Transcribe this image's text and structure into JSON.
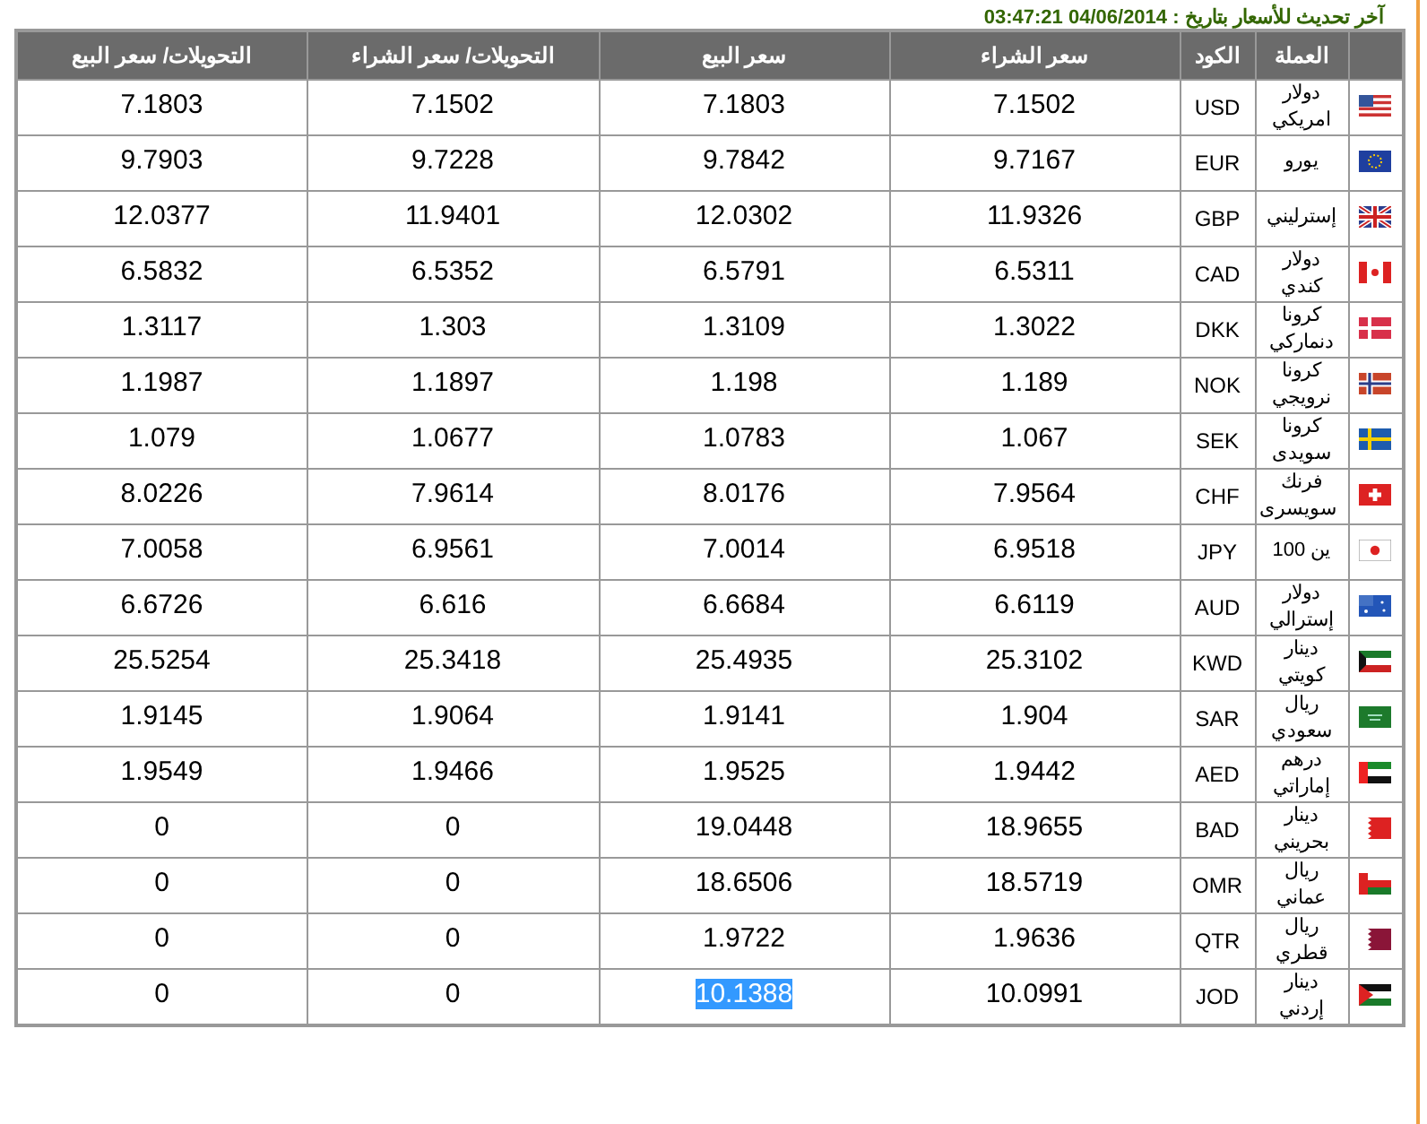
{
  "update_line": "آخر تحديث للأسعار بتاريخ : 04/06/2014 03:47:21",
  "table": {
    "columns": [
      "",
      "العملة",
      "الكود",
      "سعر الشراء",
      "سعر البيع",
      "التحويلات/ سعر الشراء",
      "التحويلات/ سعر البيع"
    ],
    "rows": [
      {
        "currency": "دولار امريكي",
        "code": "USD",
        "buy": "7.1502",
        "sell": "7.1803",
        "transfer_buy": "7.1502",
        "transfer_sell": "7.1803",
        "sell_selected": false
      },
      {
        "currency": "يورو",
        "code": "EUR",
        "buy": "9.7167",
        "sell": "9.7842",
        "transfer_buy": "9.7228",
        "transfer_sell": "9.7903",
        "sell_selected": false
      },
      {
        "currency": "إسترليني",
        "code": "GBP",
        "buy": "11.9326",
        "sell": "12.0302",
        "transfer_buy": "11.9401",
        "transfer_sell": "12.0377",
        "sell_selected": false
      },
      {
        "currency": "دولار كندي",
        "code": "CAD",
        "buy": "6.5311",
        "sell": "6.5791",
        "transfer_buy": "6.5352",
        "transfer_sell": "6.5832",
        "sell_selected": false
      },
      {
        "currency": "كرونا دنماركي",
        "code": "DKK",
        "buy": "1.3022",
        "sell": "1.3109",
        "transfer_buy": "1.303",
        "transfer_sell": "1.3117",
        "sell_selected": false
      },
      {
        "currency": "كرونا نرويجي",
        "code": "NOK",
        "buy": "1.189",
        "sell": "1.198",
        "transfer_buy": "1.1897",
        "transfer_sell": "1.1987",
        "sell_selected": false
      },
      {
        "currency": "كرونا سويدى",
        "code": "SEK",
        "buy": "1.067",
        "sell": "1.0783",
        "transfer_buy": "1.0677",
        "transfer_sell": "1.079",
        "sell_selected": false
      },
      {
        "currency": "فرنك سويسرى",
        "code": "CHF",
        "buy": "7.9564",
        "sell": "8.0176",
        "transfer_buy": "7.9614",
        "transfer_sell": "8.0226",
        "sell_selected": false
      },
      {
        "currency": "ين 100",
        "code": "JPY",
        "buy": "6.9518",
        "sell": "7.0014",
        "transfer_buy": "6.9561",
        "transfer_sell": "7.0058",
        "sell_selected": false
      },
      {
        "currency": "دولار إسترالي",
        "code": "AUD",
        "buy": "6.6119",
        "sell": "6.6684",
        "transfer_buy": "6.616",
        "transfer_sell": "6.6726",
        "sell_selected": false
      },
      {
        "currency": "دينار كويتي",
        "code": "KWD",
        "buy": "25.3102",
        "sell": "25.4935",
        "transfer_buy": "25.3418",
        "transfer_sell": "25.5254",
        "sell_selected": false
      },
      {
        "currency": "ريال سعودي",
        "code": "SAR",
        "buy": "1.904",
        "sell": "1.9141",
        "transfer_buy": "1.9064",
        "transfer_sell": "1.9145",
        "sell_selected": false
      },
      {
        "currency": "درهم إماراتي",
        "code": "AED",
        "buy": "1.9442",
        "sell": "1.9525",
        "transfer_buy": "1.9466",
        "transfer_sell": "1.9549",
        "sell_selected": false
      },
      {
        "currency": "دينار بحريني",
        "code": "BAD",
        "buy": "18.9655",
        "sell": "19.0448",
        "transfer_buy": "0",
        "transfer_sell": "0",
        "sell_selected": false
      },
      {
        "currency": "ريال عماني",
        "code": "OMR",
        "buy": "18.5719",
        "sell": "18.6506",
        "transfer_buy": "0",
        "transfer_sell": "0",
        "sell_selected": false
      },
      {
        "currency": "ريال قطري",
        "code": "QTR",
        "buy": "1.9636",
        "sell": "1.9722",
        "transfer_buy": "0",
        "transfer_sell": "0",
        "sell_selected": false
      },
      {
        "currency": "دينار إردني",
        "code": "JOD",
        "buy": "10.0991",
        "sell": "10.1388",
        "transfer_buy": "0",
        "transfer_sell": "0",
        "sell_selected": true
      }
    ]
  }
}
